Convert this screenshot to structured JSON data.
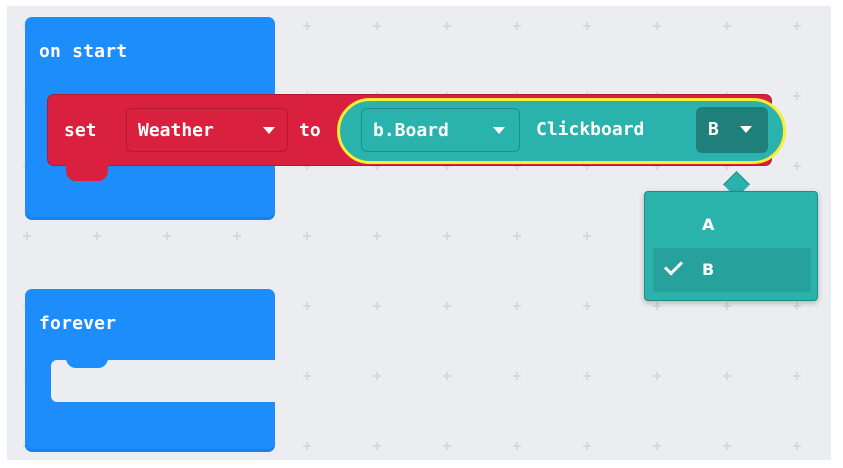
{
  "workspace": {
    "background": "#ecedf0"
  },
  "on_start_block": {
    "label": "on start",
    "color": "#1e8dfc"
  },
  "set_block": {
    "set_label": "set",
    "variable": "Weather",
    "to_label": "to",
    "color": "#d9203f"
  },
  "reporter": {
    "board_dropdown": "b.Board",
    "clickboard_label": "Clickboard",
    "selected_letter": "B",
    "color": "#2ab3ac",
    "highlight": "#f7ed32"
  },
  "dropdown_menu": {
    "options": [
      {
        "label": "A",
        "selected": false
      },
      {
        "label": "B",
        "selected": true
      }
    ]
  },
  "forever_block": {
    "label": "forever",
    "color": "#1e8dfc"
  }
}
